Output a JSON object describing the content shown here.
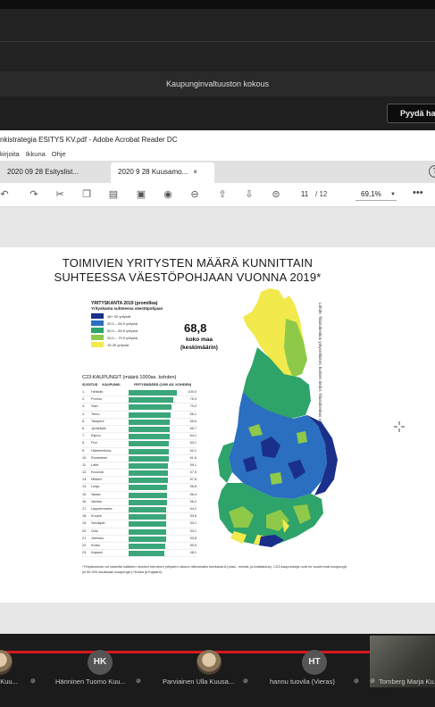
{
  "meeting": {
    "title": "Kaupunginvaltuuston kokous",
    "request_button": "Pyydä ha"
  },
  "acrobat": {
    "window_title": "nkistrategia ESITYS KV.pdf - Adobe Acrobat Reader DC",
    "menu": [
      "kirjoita",
      "Ikkuna",
      "Ohje"
    ],
    "tabs": [
      {
        "label": "2020 09 28 Esityslist...",
        "active": false
      },
      {
        "label": "2020 9 28 Kuusamo...",
        "active": true,
        "close": "×"
      }
    ],
    "toolbar": {
      "icons": [
        "undo-icon",
        "redo-icon",
        "cut-icon",
        "copy-icon",
        "clipboard-icon",
        "camera-icon",
        "binoculars-icon",
        "sign-icon",
        "page-up-icon",
        "page-down-icon",
        "fit-icon"
      ],
      "page_current": "11",
      "page_total": "/ 12",
      "zoom": "69,1%",
      "more": "•••",
      "help": "?"
    }
  },
  "slide": {
    "title_line1": "TOIMIVIEN YRITYSTEN MÄÄRÄ KUNNITTAIN",
    "title_line2": "SUHTEESSA VÄESTÖPOHJAAN VUONNA 2019*",
    "legend_title": "YRITYSKANTA 2019 (promillea)",
    "legend_subtitle": "Yrityskanta suhteessa väestöpohjaan",
    "legend": [
      {
        "label": "48+ 50 yritystä",
        "color": "#1a2f8a"
      },
      {
        "label": "30,0 – 56,9 yritystä",
        "color": "#2a6fc0"
      },
      {
        "label": "50,0 – 89,9 yritystä",
        "color": "#2ea36a"
      },
      {
        "label": "20,0 – 79,9 yritystä",
        "color": "#8ec94a"
      },
      {
        "label": "15-30 yritystä",
        "color": "#f2ea4c"
      }
    ],
    "average_value": "68,8",
    "average_label1": "koko maa",
    "average_label2": "(keskimäärin)",
    "source": "Lähde: Tilastokeskus yritysrekisteri, kuntien tiedot; Tilastokeskus väestö; Toim. 2020",
    "table_title": "C23-KAUPUNGIT (määrä 1000as. kohden)",
    "table_headers": [
      "SIJOITUS",
      "KAUPUNKI",
      "YRITYSMÄÄRÄ (1000 AS. KOHDEN)"
    ],
    "table_rows": [
      {
        "rank": "1.",
        "city": "Helsinki",
        "value": "100,0",
        "pct": 100
      },
      {
        "rank": "2.",
        "city": "Porvoo",
        "value": "76,3",
        "pct": 92
      },
      {
        "rank": "3.",
        "city": "Salo",
        "value": "70,0",
        "pct": 89
      },
      {
        "rank": "4.",
        "city": "Turku",
        "value": "66,1",
        "pct": 87
      },
      {
        "rank": "5.",
        "city": "Tampere",
        "value": "65,6",
        "pct": 86
      },
      {
        "rank": "6.",
        "city": "Jyväskylä",
        "value": "65,7",
        "pct": 86
      },
      {
        "rank": "7.",
        "city": "Espoo",
        "value": "64,1",
        "pct": 85
      },
      {
        "rank": "8.",
        "city": "Pori",
        "value": "63,1",
        "pct": 84
      },
      {
        "rank": "9.",
        "city": "Hämeenlinna",
        "value": "62,1",
        "pct": 83
      },
      {
        "rank": "10.",
        "city": "Rovaniemi",
        "value": "61,6",
        "pct": 83
      },
      {
        "rank": "11.",
        "city": "Lahti",
        "value": "59,1",
        "pct": 82
      },
      {
        "rank": "12.",
        "city": "Kouvola",
        "value": "57,9",
        "pct": 81
      },
      {
        "rank": "13.",
        "city": "Mikkeli",
        "value": "57,8",
        "pct": 81
      },
      {
        "rank": "14.",
        "city": "Lohja",
        "value": "56,8",
        "pct": 80
      },
      {
        "rank": "15.",
        "city": "Vaasa",
        "value": "56,4",
        "pct": 80
      },
      {
        "rank": "16.",
        "city": "Vantaa",
        "value": "56,2",
        "pct": 79
      },
      {
        "rank": "17.",
        "city": "Lappeenranta",
        "value": "54,2",
        "pct": 78
      },
      {
        "rank": "18.",
        "city": "Kuopio",
        "value": "53,6",
        "pct": 78
      },
      {
        "rank": "19.",
        "city": "Seinäjoki",
        "value": "53,1",
        "pct": 77
      },
      {
        "rank": "20.",
        "city": "Oulu",
        "value": "53,1",
        "pct": 77
      },
      {
        "rank": "21.",
        "city": "Joensuu",
        "value": "53,8",
        "pct": 77
      },
      {
        "rank": "22.",
        "city": "Kotka",
        "value": "50,5",
        "pct": 76
      },
      {
        "rank": "23.",
        "city": "Kajaani",
        "value": "48,1",
        "pct": 74
      }
    ],
    "footnote": "*Yrityskannan on laskettu kaikkien muiden toimivien yritysten lukuun otteamatta toimialaa A (maa-, metsä- ja kalatalous). C23-kaupunkeja ovat ne suurimmat kaupungit yli 50 000 asukkaan kaupungit (+Kotka ja Kajaani)."
  },
  "participants": [
    {
      "initials": "",
      "name": "a Kuu...",
      "mic": "muted"
    },
    {
      "initials": "HK",
      "name": "Hänninen Tuomo Kuu...",
      "mic": "muted"
    },
    {
      "initials": "",
      "name": "Parviainen Ulla Kuusa...",
      "mic": "muted"
    },
    {
      "initials": "HT",
      "name": "hannu tuovila (Vieras)",
      "mic": "muted"
    },
    {
      "initials": "",
      "name": "Tornberg Marja Ku...",
      "mic": "muted"
    }
  ]
}
